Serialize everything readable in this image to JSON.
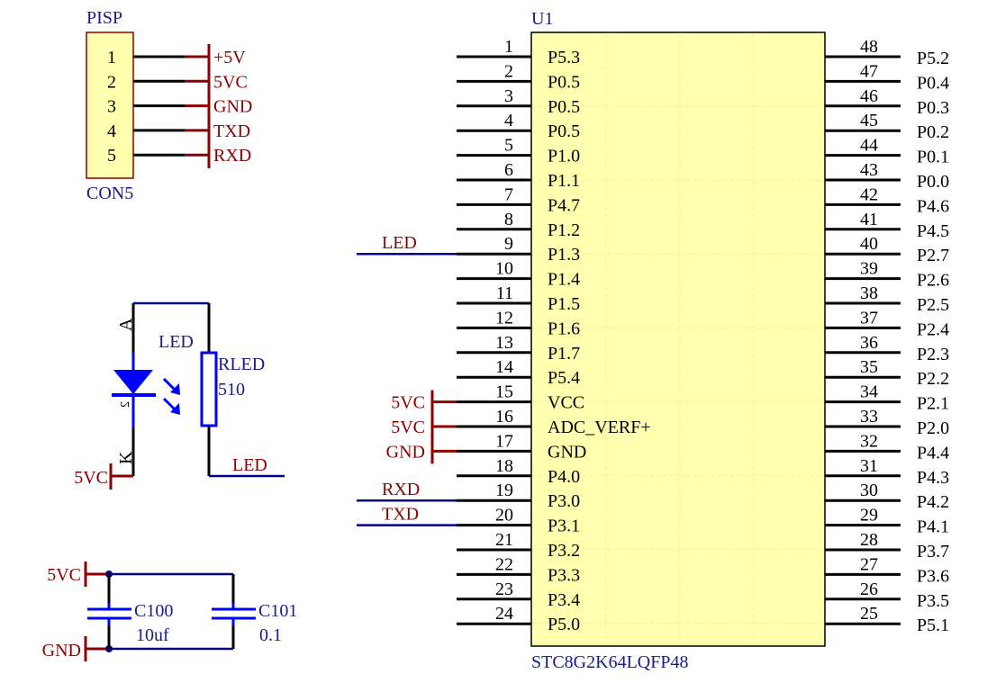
{
  "colors": {
    "component_fill": "#ffffb0",
    "component_border": "#8b0000",
    "chip_border": "#000000",
    "wire": "#00008b",
    "net_label": "#8b0000",
    "designator": "#1a1a8c",
    "device": "#0000ff",
    "pin": "#000000"
  },
  "connector": {
    "designator": "PISP",
    "comment": "CON5",
    "pins": [
      {
        "num": "1",
        "net": "+5V"
      },
      {
        "num": "2",
        "net": "5VC"
      },
      {
        "num": "3",
        "net": "GND"
      },
      {
        "num": "4",
        "net": "TXD"
      },
      {
        "num": "5",
        "net": "RXD"
      }
    ]
  },
  "chip": {
    "designator": "U1",
    "comment": "STC8G2K64LQFP48",
    "left_pins": [
      {
        "num": "1",
        "name": "P5.3",
        "net": ""
      },
      {
        "num": "2",
        "name": "P0.5",
        "net": ""
      },
      {
        "num": "3",
        "name": "P0.5",
        "net": ""
      },
      {
        "num": "4",
        "name": "P0.5",
        "net": ""
      },
      {
        "num": "5",
        "name": "P1.0",
        "net": ""
      },
      {
        "num": "6",
        "name": "P1.1",
        "net": ""
      },
      {
        "num": "7",
        "name": "P4.7",
        "net": ""
      },
      {
        "num": "8",
        "name": "P1.2",
        "net": ""
      },
      {
        "num": "9",
        "name": "P1.3",
        "net": "LED",
        "net_type": "wire"
      },
      {
        "num": "10",
        "name": "P1.4",
        "net": ""
      },
      {
        "num": "11",
        "name": "P1.5",
        "net": ""
      },
      {
        "num": "12",
        "name": "P1.6",
        "net": ""
      },
      {
        "num": "13",
        "name": "P1.7",
        "net": ""
      },
      {
        "num": "14",
        "name": "P5.4",
        "net": ""
      },
      {
        "num": "15",
        "name": "VCC",
        "net": "5VC",
        "net_type": "port"
      },
      {
        "num": "16",
        "name": "ADC_VERF+",
        "net": "5VC",
        "net_type": "port"
      },
      {
        "num": "17",
        "name": "GND",
        "net": "GND",
        "net_type": "port"
      },
      {
        "num": "18",
        "name": "P4.0",
        "net": ""
      },
      {
        "num": "19",
        "name": "P3.0",
        "net": "RXD",
        "net_type": "wire"
      },
      {
        "num": "20",
        "name": "P3.1",
        "net": "TXD",
        "net_type": "wire"
      },
      {
        "num": "21",
        "name": "P3.2",
        "net": ""
      },
      {
        "num": "22",
        "name": "P3.3",
        "net": ""
      },
      {
        "num": "23",
        "name": "P3.4",
        "net": ""
      },
      {
        "num": "24",
        "name": "P5.0",
        "net": ""
      }
    ],
    "right_pins": [
      {
        "num": "48",
        "name": "P5.2"
      },
      {
        "num": "47",
        "name": "P0.4"
      },
      {
        "num": "46",
        "name": "P0.3"
      },
      {
        "num": "45",
        "name": "P0.2"
      },
      {
        "num": "44",
        "name": "P0.1"
      },
      {
        "num": "43",
        "name": "P0.0"
      },
      {
        "num": "42",
        "name": "P4.6"
      },
      {
        "num": "41",
        "name": "P4.5"
      },
      {
        "num": "40",
        "name": "P2.7"
      },
      {
        "num": "39",
        "name": "P2.6"
      },
      {
        "num": "38",
        "name": "P2.5"
      },
      {
        "num": "37",
        "name": "P2.4"
      },
      {
        "num": "36",
        "name": "P2.3"
      },
      {
        "num": "35",
        "name": "P2.2"
      },
      {
        "num": "34",
        "name": "P2.1"
      },
      {
        "num": "33",
        "name": "P2.0"
      },
      {
        "num": "32",
        "name": "P4.4"
      },
      {
        "num": "31",
        "name": "P4.3"
      },
      {
        "num": "30",
        "name": "P4.2"
      },
      {
        "num": "29",
        "name": "P4.1"
      },
      {
        "num": "28",
        "name": "P3.7"
      },
      {
        "num": "27",
        "name": "P3.6"
      },
      {
        "num": "26",
        "name": "P3.5"
      },
      {
        "num": "25",
        "name": "P5.1"
      }
    ]
  },
  "led_circuit": {
    "led": {
      "designator": "LED",
      "anode_label": "A",
      "cathode_label": "K",
      "pin_mark": "2"
    },
    "resistor": {
      "designator": "RLED",
      "value": "510"
    },
    "cathode_net": "5VC",
    "output_net": "LED"
  },
  "caps": {
    "top_net": "5VC",
    "bottom_net": "GND",
    "items": [
      {
        "designator": "C100",
        "value": "10uf"
      },
      {
        "designator": "C101",
        "value": "0.1"
      }
    ]
  }
}
